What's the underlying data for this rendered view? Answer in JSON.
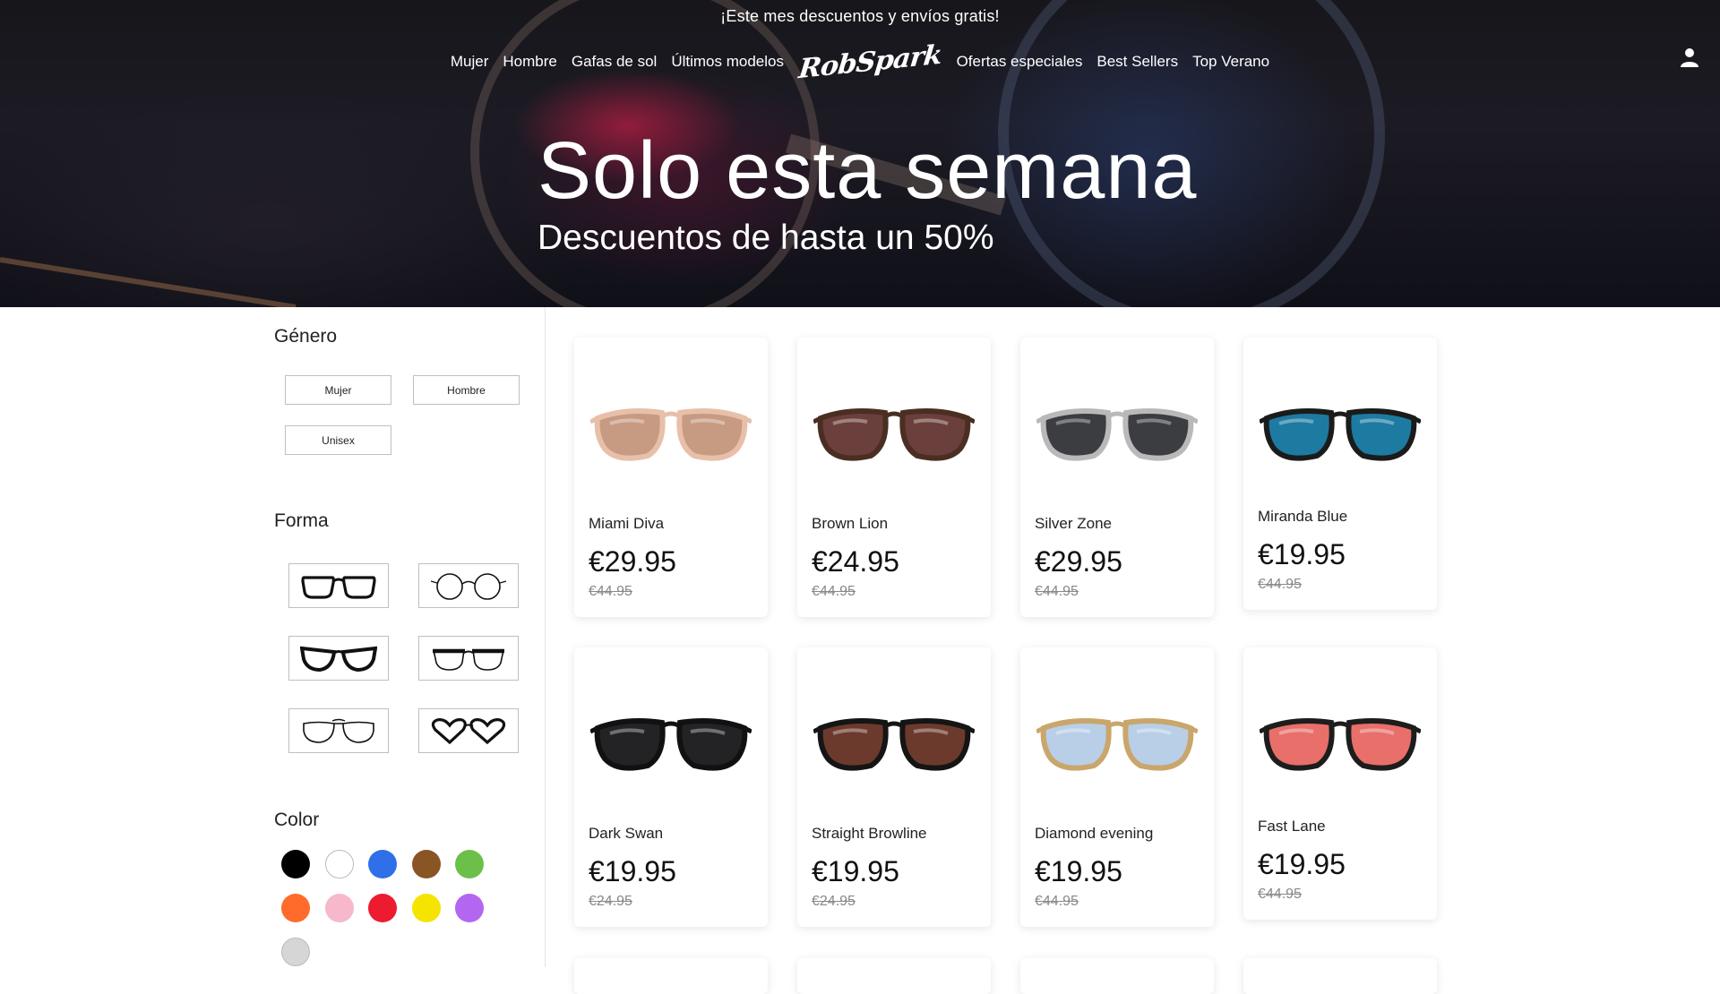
{
  "promo": "¡Este mes descuentos y envíos gratis!",
  "nav": {
    "left": [
      "Mujer",
      "Hombre",
      "Gafas de sol",
      "Últimos modelos"
    ],
    "logo": "RobSpark",
    "right": [
      "Ofertas especiales",
      "Best Sellers",
      "Top Verano"
    ],
    "user_icon": "user-icon"
  },
  "hero": {
    "title": "Solo esta semana",
    "subtitle": "Descuentos de hasta un 50%"
  },
  "filters": {
    "gender": {
      "heading": "Género",
      "options": [
        "Mujer",
        "Hombre",
        "Unisex"
      ]
    },
    "shape": {
      "heading": "Forma",
      "options": [
        "rectangular-frame-icon",
        "round-frame-icon",
        "cat-eye-frame-icon",
        "browline-frame-icon",
        "aviator-frame-icon",
        "heart-frame-icon"
      ]
    },
    "color": {
      "heading": "Color",
      "swatches": [
        "#000000",
        "#ffffff",
        "#2f6fe8",
        "#8a5525",
        "#6cc04a",
        "#ff6b2b",
        "#f7b8cc",
        "#ec1b30",
        "#f5e400",
        "#b366f0",
        "#d6d6d6"
      ]
    }
  },
  "products": [
    {
      "name": "Miami Diva",
      "price": "€29.95",
      "old_price": "€44.95",
      "lens": "#c79a82",
      "frame": "#e8bfa8"
    },
    {
      "name": "Brown Lion",
      "price": "€24.95",
      "old_price": "€44.95",
      "lens": "#6b3f3b",
      "frame": "#4a2e22"
    },
    {
      "name": "Silver Zone",
      "price": "€29.95",
      "old_price": "€44.95",
      "lens": "#3c3d40",
      "frame": "#b9b9b9"
    },
    {
      "name": "Miranda Blue",
      "price": "€19.95",
      "old_price": "€44.95",
      "lens": "#1d7aa0",
      "frame": "#1b1b1b"
    },
    {
      "name": "Dark Swan",
      "price": "€19.95",
      "old_price": "€24.95",
      "lens": "#232325",
      "frame": "#111111"
    },
    {
      "name": "Straight Browline",
      "price": "€19.95",
      "old_price": "€24.95",
      "lens": "#6b3a2c",
      "frame": "#151515"
    },
    {
      "name": "Diamond evening",
      "price": "€19.95",
      "old_price": "€44.95",
      "lens": "#b9cfe8",
      "frame": "#c9a66b"
    },
    {
      "name": "Fast Lane",
      "price": "€19.95",
      "old_price": "€44.95",
      "lens": "#e86f6a",
      "frame": "#1d1d1d"
    }
  ]
}
